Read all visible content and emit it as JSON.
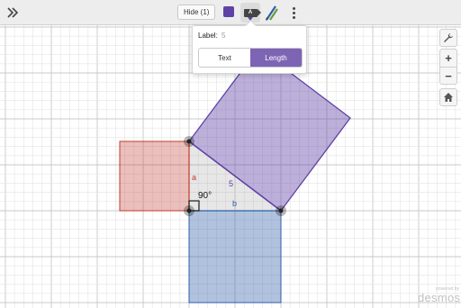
{
  "toolbar": {
    "hide_label": "Hide (1)",
    "selected_color": "#6042a6",
    "label_tool_glyph": "A"
  },
  "label_popover": {
    "label_caption": "Label:",
    "label_value": "5",
    "mode_options": [
      "Text",
      "Length"
    ],
    "selected_mode": "Length"
  },
  "graph": {
    "angle_label": "90°",
    "side_a_label": "a",
    "side_b_label": "b",
    "hypotenuse_label": "5",
    "colors": {
      "square_a": "#c0392b",
      "square_b": "#2f5fa8",
      "square_c": "#6042a6",
      "grid_minor": "#e4e4e4",
      "grid_major": "#c8c8c8"
    }
  },
  "side_controls": {
    "settings_icon": "wrench-icon",
    "zoom_in": "+",
    "zoom_out": "−",
    "home_icon": "home-icon"
  },
  "watermark": {
    "small": "powered by",
    "brand": "desmos"
  }
}
